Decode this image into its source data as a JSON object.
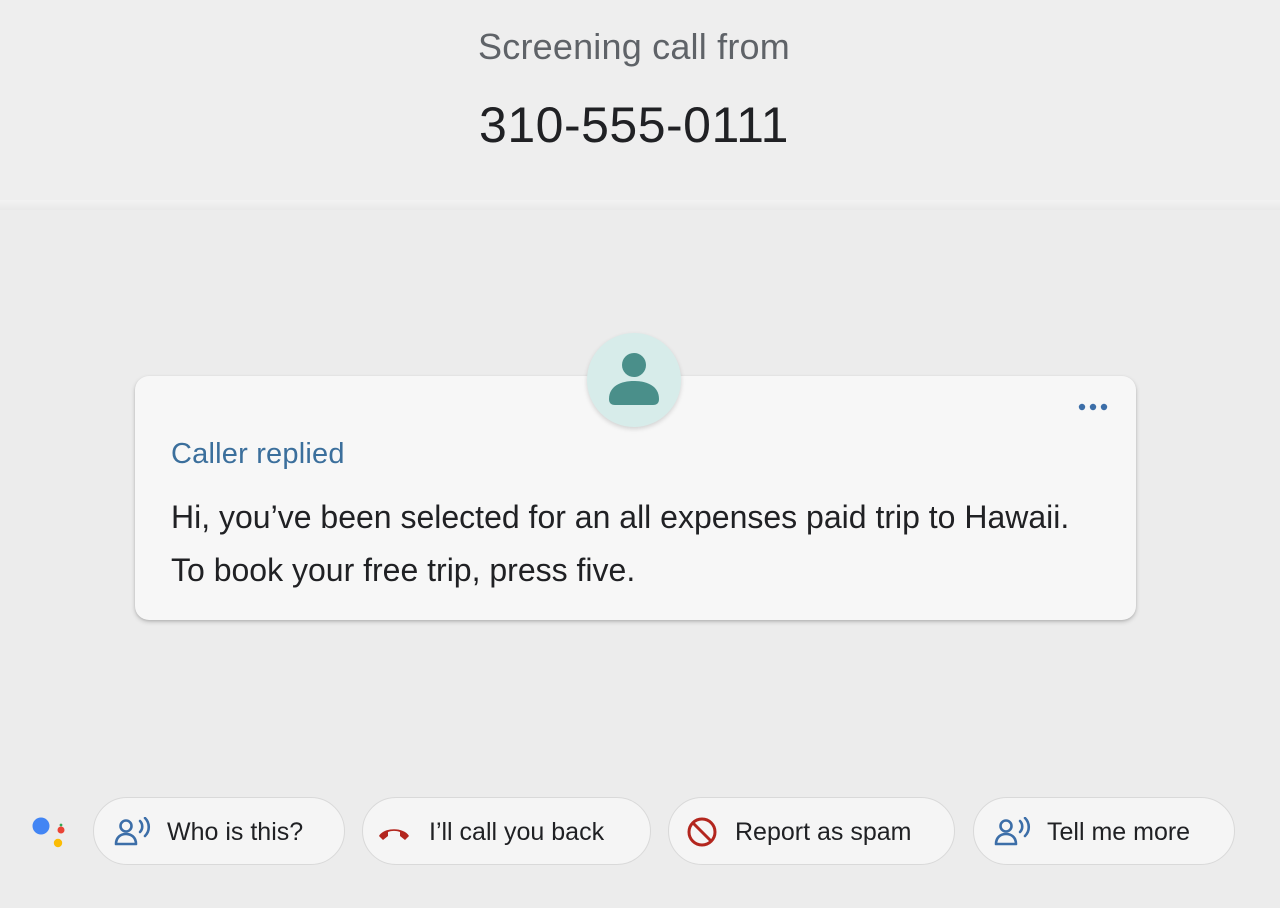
{
  "header": {
    "label": "Screening call from",
    "phone_number": "310-555-0111"
  },
  "card": {
    "avatar_icon": "person-icon",
    "menu_icon": "more-horizontal-icon",
    "label": "Caller replied",
    "message": "Hi, you’ve been selected for an all expenses paid trip to Hawaii. To book your free trip, press five."
  },
  "assistant": {
    "icon": "google-assistant-icon"
  },
  "chips": [
    {
      "label": "Who is this?",
      "icon": "speaking-person-icon"
    },
    {
      "label": "I’ll call you back",
      "icon": "hang-up-phone-icon"
    },
    {
      "label": "Report as spam",
      "icon": "block-icon"
    },
    {
      "label": "Tell me more",
      "icon": "speaking-person-icon"
    }
  ],
  "colors": {
    "background": "#ececec",
    "accent_label": "#3b6f9c",
    "icon_blue": "#3c6ea8",
    "hangup_red": "#b3261e",
    "avatar_bg": "#d7ecea",
    "avatar_fg": "#4a8f8a"
  }
}
